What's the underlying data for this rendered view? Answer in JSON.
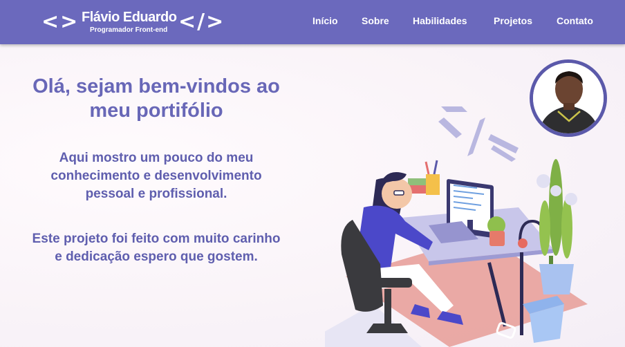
{
  "header": {
    "logo_left": "<>",
    "logo_name": "Flávio Eduardo",
    "logo_right": "</>",
    "logo_role": "Programador Front-end"
  },
  "nav": [
    {
      "label": "Início"
    },
    {
      "label": "Sobre"
    },
    {
      "label": "Habilidades"
    },
    {
      "label": "Projetos"
    },
    {
      "label": "Contato"
    }
  ],
  "hero": {
    "title_line1": "Olá, sejam bem-vindos ao",
    "title_line2": "meu portifólio",
    "p1_line1": "Aqui mostro um pouco do meu",
    "p1_line2": "conhecimento e desenvolvimento",
    "p1_line3": "pessoal e profissional.",
    "p2_line1": "Este projeto foi feito com muito carinho",
    "p2_line2": "e dedicação espero que gostem."
  },
  "colors": {
    "header_bg": "#6b69bd",
    "heading": "#6867b7",
    "text": "#5f5eae",
    "avatar_border": "#5b59aa"
  },
  "icons": [
    "code-brackets-icon",
    "profile-photo",
    "developer-illustration"
  ]
}
